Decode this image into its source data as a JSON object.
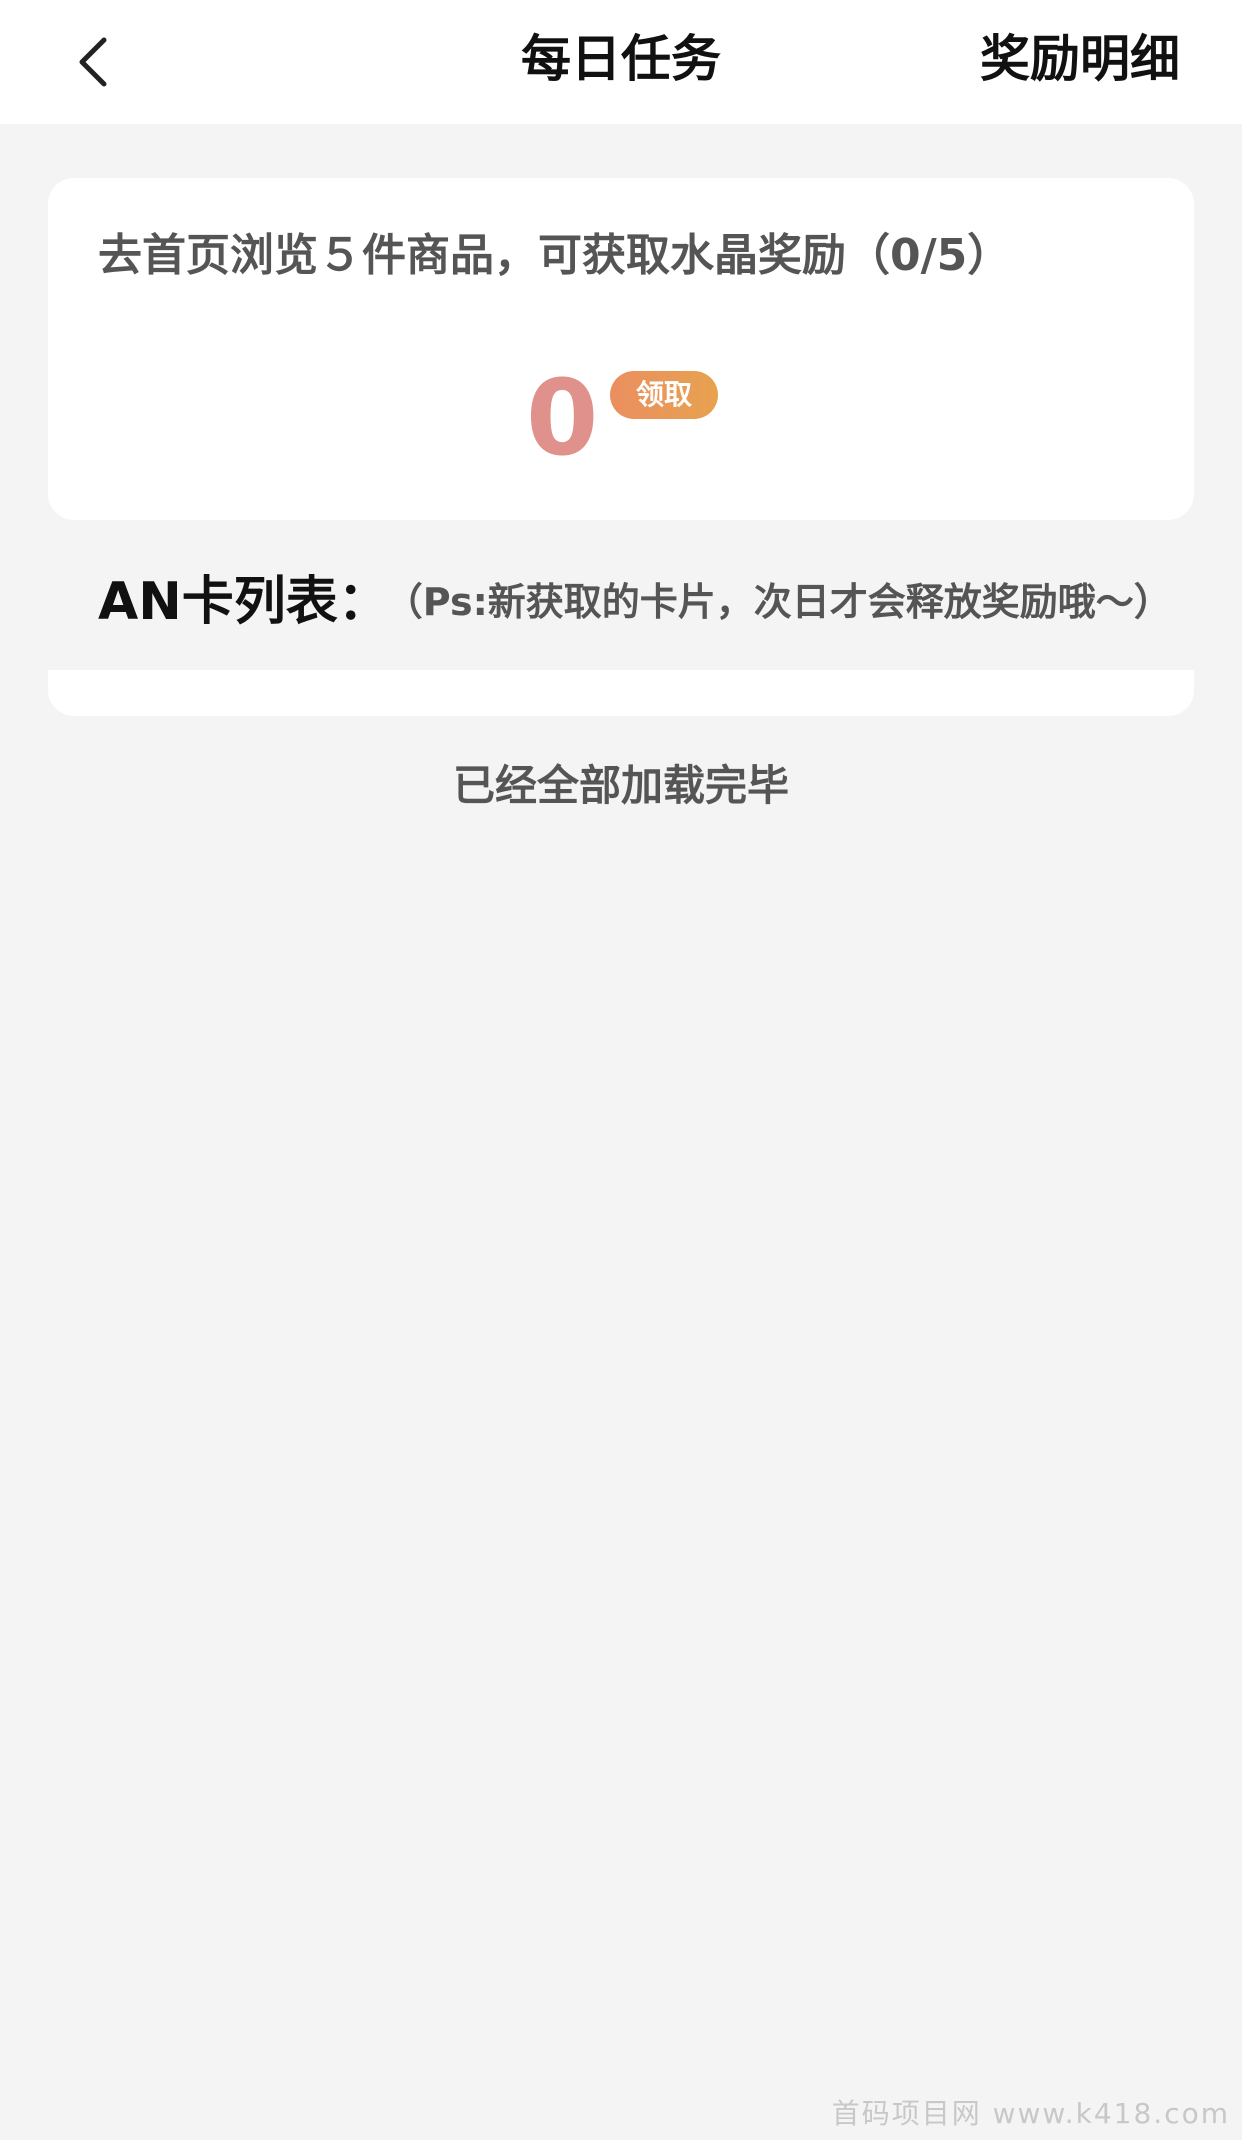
{
  "header": {
    "title": "每日任务",
    "right_link": "奖励明细",
    "back_icon": "chevron-left-icon"
  },
  "task": {
    "text": "去首页浏览５件商品，可获取水晶奖励（0/5）",
    "reward_count": "0",
    "claim_label": "领取"
  },
  "card_list": {
    "title": "AN卡列表：",
    "note": "（Ps:新获取的卡片，次日才会释放奖励哦～）"
  },
  "footer": {
    "load_complete": "已经全部加载完毕"
  },
  "watermark": "首码项目网 www.k418.com",
  "colors": {
    "background": "#f4f4f4",
    "card": "#ffffff",
    "reward_count": "#e0918b",
    "claim_gradient_start": "#ea8f60",
    "claim_gradient_end": "#e8a24f"
  }
}
